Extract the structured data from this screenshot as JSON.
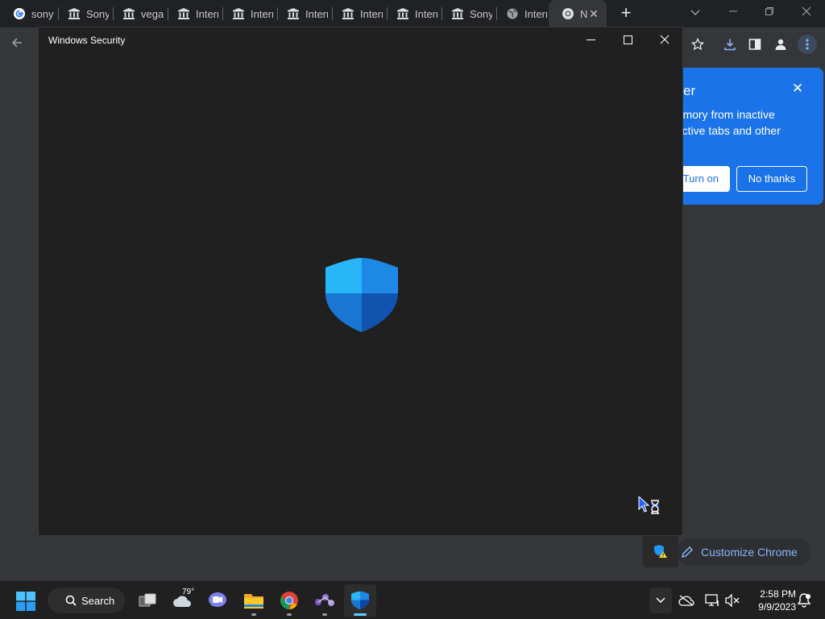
{
  "browser": {
    "tabs": [
      {
        "title": "sony",
        "icon": "google-icon"
      },
      {
        "title": "Sony",
        "icon": "museum-icon"
      },
      {
        "title": "vegas",
        "icon": "museum-icon"
      },
      {
        "title": "Intern",
        "icon": "museum-icon"
      },
      {
        "title": "Intern",
        "icon": "museum-icon"
      },
      {
        "title": "Intern",
        "icon": "museum-icon"
      },
      {
        "title": "Intern",
        "icon": "museum-icon"
      },
      {
        "title": "Intern",
        "icon": "museum-icon"
      },
      {
        "title": "Sony",
        "icon": "museum-icon"
      },
      {
        "title": "Intern",
        "icon": "globe-icon"
      },
      {
        "title": "N",
        "icon": "chrome-icon",
        "active": true
      }
    ],
    "new_tab_label": "+",
    "popup": {
      "title_fragment": "er",
      "line1": "memory from inactive",
      "line2": "y active tabs and other",
      "turn_on_label": "Turn on",
      "no_thanks_label": "No thanks"
    },
    "customize_label": "Customize Chrome",
    "accent_color": "#1a73e8"
  },
  "security_window": {
    "title": "Windows Security",
    "shield_colors": [
      "#4fc3f7",
      "#1e88e5",
      "#1565c0"
    ]
  },
  "taskbar": {
    "search_label": "Search",
    "weather_temp": "79°",
    "time": "2:58 PM",
    "date": "9/9/2023"
  }
}
